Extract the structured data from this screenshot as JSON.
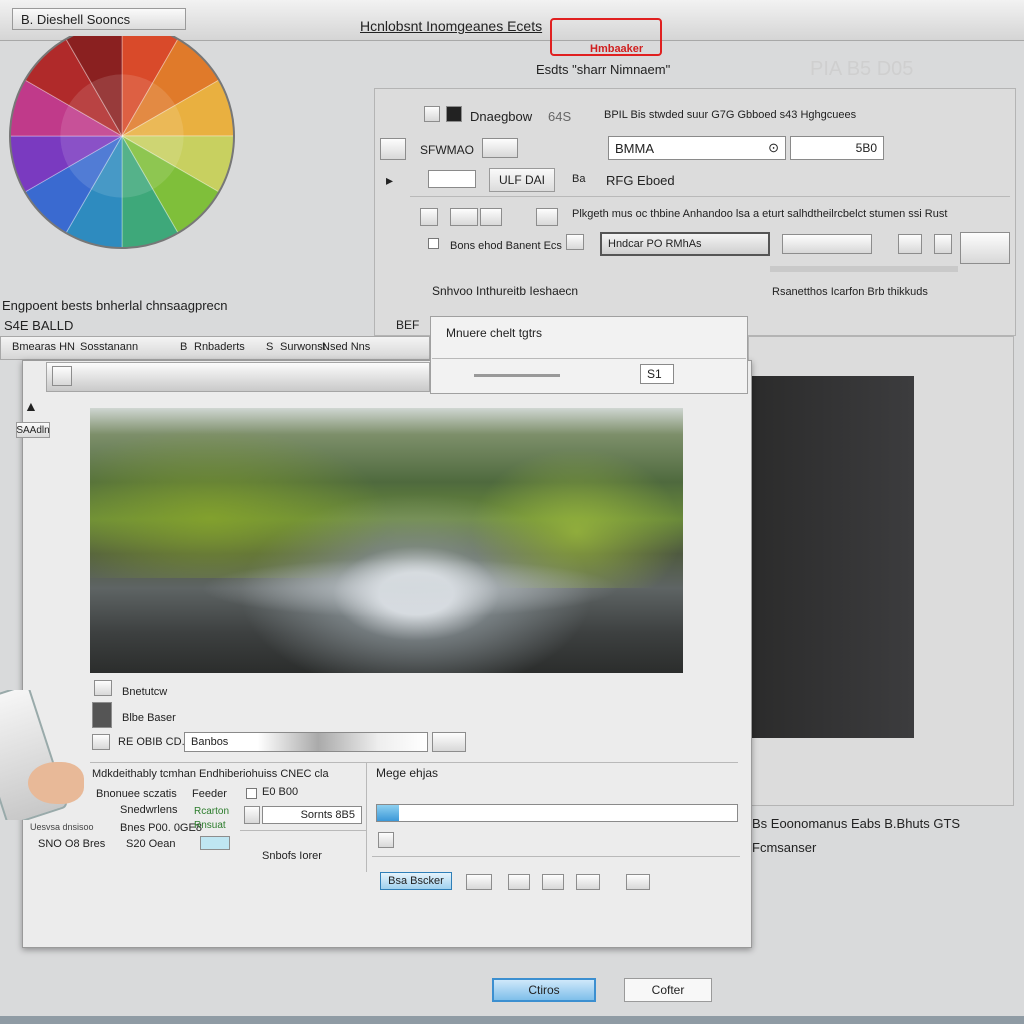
{
  "app": {
    "title": "B. Dieshell Sooncs",
    "header_link": "Hcnlobsnt Inomgeanes Ecets",
    "subtitle": "Esdts \"sharr Nimnaem\"",
    "annotation": "Hmbaaker",
    "ghost_label": "PIA B5 D05"
  },
  "color_wheel": {
    "caption_a": "Engpoent bests bnherlal chnsaagprecn",
    "caption_b": "S4E BALLD",
    "colors": [
      "#d94a2a",
      "#e07a2a",
      "#e9b040",
      "#c8d060",
      "#7fbf3a",
      "#3ea87a",
      "#2e8bbf",
      "#3a6ad0",
      "#7a3ac0",
      "#c03a8a",
      "#b02a2a",
      "#8a2020"
    ]
  },
  "settings": {
    "row1_label": "Dnaegbow",
    "row1_value": "64S",
    "row1_desc": "BPIL Bis  stwded  suur G7G Gbboed  s43  Hghgcuees",
    "row2_label": "SFWMAO",
    "row2_field": "BMMA",
    "row2_spin": "5B0",
    "row3_btn": "ULF DAI",
    "row3_marker": "Ba",
    "row3_label": "RFG Eboed",
    "row4_desc": "Plkgeth  mus  oc thbine  Anhandoo  lsa  a  eturt  salhdtheilrcbelct  stumen  ssi  Rust",
    "row5_label": "Bons  ehod  Banent  Ecs",
    "row5_combo": "Hndcar  PO  RMhAs",
    "row6_label": "Snhvoo  Inthureitb  Ieshaecn",
    "row6_right": "Rsanetthos  Icarfon  Brb  thikkuds"
  },
  "toolbar2": {
    "left_btn": "BEF",
    "items": [
      "Bmearas HN",
      "Sosstanann",
      "B",
      "Rnbaderts",
      "S",
      "Surwonst",
      "Nsed  Nns"
    ],
    "mid_label": "Mnuere  chelt  tgtrs",
    "left_icon_label": "SAAdln",
    "field_value": "S1"
  },
  "dialog": {
    "row_a": "Bnetutcw",
    "row_b": "Blbe  Baser",
    "row_c_prefix": "RE  OBIB  CD.",
    "row_c_field": "Banbos",
    "list_title": "Mdkdeithably  tcmhan  Endhiberiohuiss  CNEC  cla",
    "list_rows": [
      [
        "Bnonuee  sczatis",
        "Feeder"
      ],
      [
        "Snedwrlens",
        "Rcarton"
      ],
      [
        "Bnes  P00.  0GE8",
        "Rnsuat"
      ],
      [
        "SNO  O8  Bres",
        "S20  Oean"
      ]
    ],
    "chk_label": "E0 B00",
    "num_field": "Sornts  8B5",
    "footer_label": "Snbofs  Iorer",
    "right_title": "Mege  ehjas",
    "right_btn_primary": "Bsa  Bscker",
    "right_desc": "Bs  Eoonomanus  Eabs  B.Bhuts  GTS",
    "right_desc2": "Fcmsanser"
  },
  "footer": {
    "ok": "Ctiros",
    "cancel": "Cofter"
  }
}
